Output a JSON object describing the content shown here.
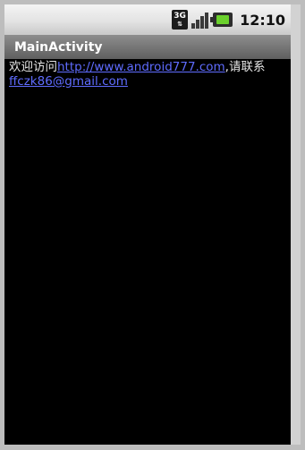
{
  "status_bar": {
    "network_label": "3G",
    "time": "12:10",
    "icons": [
      "network-3g-icon",
      "signal-strength-icon",
      "battery-charging-icon"
    ]
  },
  "title_bar": {
    "title": "MainActivity"
  },
  "content": {
    "prefix": "欢迎访问",
    "link_url": "http://www.android777.com",
    "middle": ",请联系",
    "email": "ffczk86@gmail.com"
  },
  "colors": {
    "background": "#000000",
    "link": "#5f6cff",
    "text": "#e6e6e6",
    "battery": "#6bd12d"
  }
}
